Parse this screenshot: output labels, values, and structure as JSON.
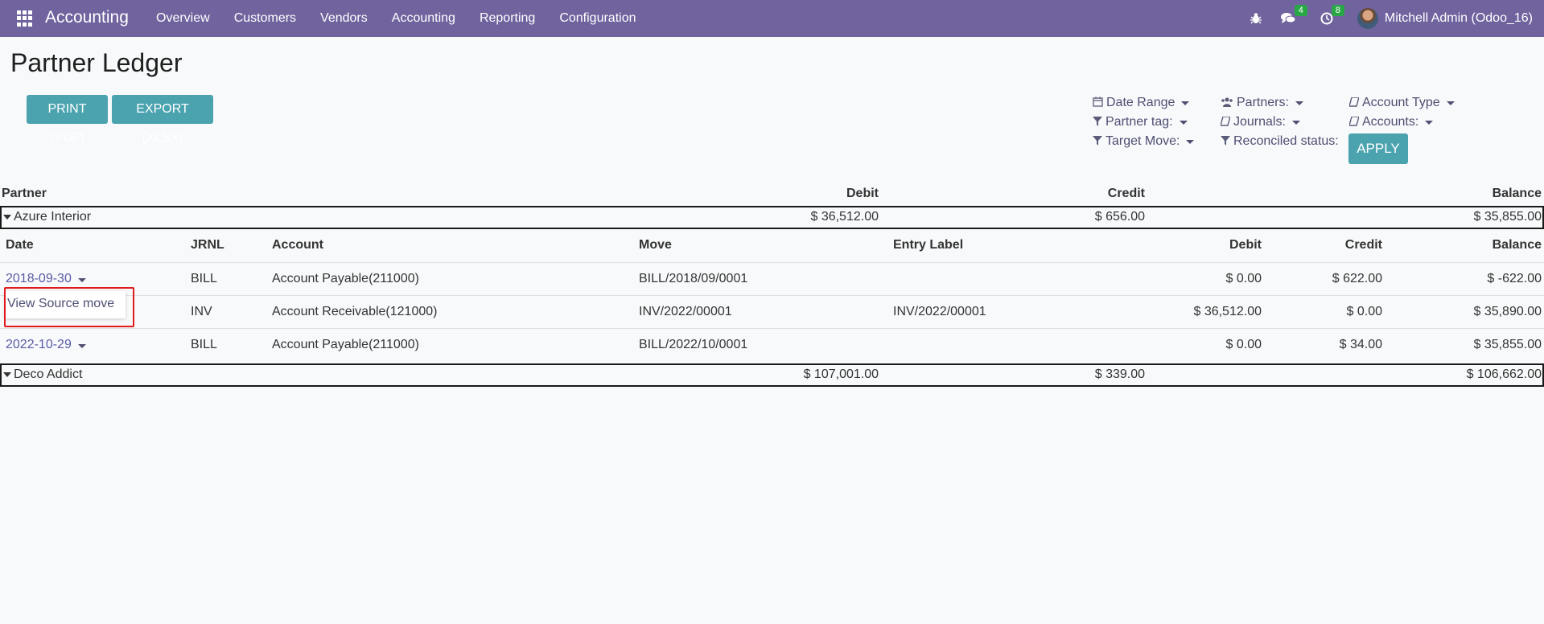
{
  "navbar": {
    "app_title": "Accounting",
    "menu": [
      "Overview",
      "Customers",
      "Vendors",
      "Accounting",
      "Reporting",
      "Configuration"
    ],
    "messages_count": "4",
    "activities_count": "8",
    "user": "Mitchell Admin (Odoo_16)"
  },
  "page": {
    "title": "Partner Ledger",
    "print_label": "PRINT (PDF)",
    "export_label": "EXPORT (XLSX)",
    "apply_label": "APPLY"
  },
  "filters": {
    "date_range": "Date Range",
    "partner_tag": "Partner tag:",
    "target_move": "Target Move:",
    "partners": "Partners:",
    "journals": "Journals:",
    "reconciled": "Reconciled status:",
    "account_type": "Account Type",
    "accounts": "Accounts:"
  },
  "table": {
    "headers": {
      "partner": "Partner",
      "debit": "Debit",
      "credit": "Credit",
      "balance": "Balance"
    },
    "sub_headers": {
      "date": "Date",
      "jrnl": "JRNL",
      "account": "Account",
      "move": "Move",
      "label": "Entry Label",
      "debit": "Debit",
      "credit": "Credit",
      "balance": "Balance"
    },
    "partners": [
      {
        "name": "Azure Interior",
        "debit": "$ 36,512.00",
        "credit": "$ 656.00",
        "balance": "$ 35,855.00"
      },
      {
        "name": "Deco Addict",
        "debit": "$ 107,001.00",
        "credit": "$ 339.00",
        "balance": "$ 106,662.00"
      }
    ],
    "lines": [
      {
        "date": "2018-09-30",
        "jrnl": "BILL",
        "account": "Account Payable(211000)",
        "move": "BILL/2018/09/0001",
        "label": "",
        "debit": "$ 0.00",
        "credit": "$ 622.00",
        "balance": "$ -622.00"
      },
      {
        "date": "",
        "jrnl": "INV",
        "account": "Account Receivable(121000)",
        "move": "INV/2022/00001",
        "label": "INV/2022/00001",
        "debit": "$ 36,512.00",
        "credit": "$ 0.00",
        "balance": "$ 35,890.00"
      },
      {
        "date": "2022-10-29",
        "jrnl": "BILL",
        "account": "Account Payable(211000)",
        "move": "BILL/2022/10/0001",
        "label": "",
        "debit": "$ 0.00",
        "credit": "$ 34.00",
        "balance": "$ 35,855.00"
      }
    ]
  },
  "popup": {
    "label": "View Source move"
  }
}
